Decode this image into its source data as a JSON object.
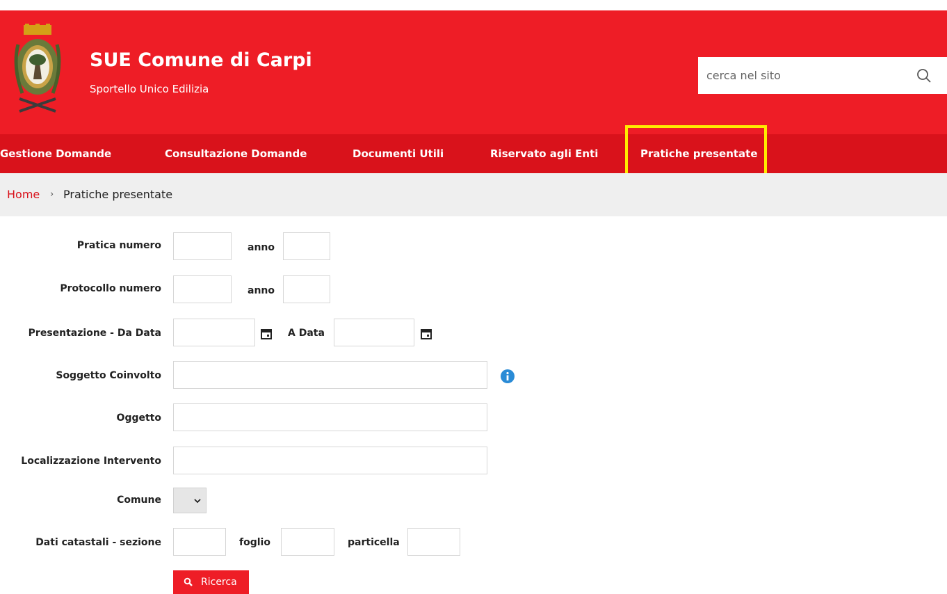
{
  "header": {
    "title": "SUE Comune di Carpi",
    "subtitle": "Sportello Unico Edilizia",
    "logo_icon": "coat-of-arms-icon"
  },
  "search": {
    "placeholder": "cerca nel sito",
    "icon": "search-icon"
  },
  "nav": {
    "items": [
      {
        "label": "Gestione Domande"
      },
      {
        "label": "Consultazione Domande"
      },
      {
        "label": "Documenti Utili"
      },
      {
        "label": "Riservato agli Enti"
      },
      {
        "label": "Pratiche presentate"
      }
    ]
  },
  "breadcrumb": {
    "home": "Home",
    "separator": "›",
    "current": "Pratiche presentate"
  },
  "form": {
    "pratica_numero": "Pratica numero",
    "anno": "anno",
    "protocollo_numero": "Protocollo numero",
    "presentazione_da": "Presentazione - Da Data",
    "a_data": "A Data",
    "soggetto": "Soggetto Coinvolto",
    "oggetto": "Oggetto",
    "localizzazione": "Localizzazione Intervento",
    "comune": "Comune",
    "dati_catastali": "Dati catastali - sezione",
    "foglio": "foglio",
    "particella": "particella",
    "submit": "Ricerca"
  },
  "colors": {
    "header_red": "#ee1d26",
    "nav_red": "#d9121b",
    "highlight": "#ffea00",
    "info_blue": "#2a8bd6"
  }
}
